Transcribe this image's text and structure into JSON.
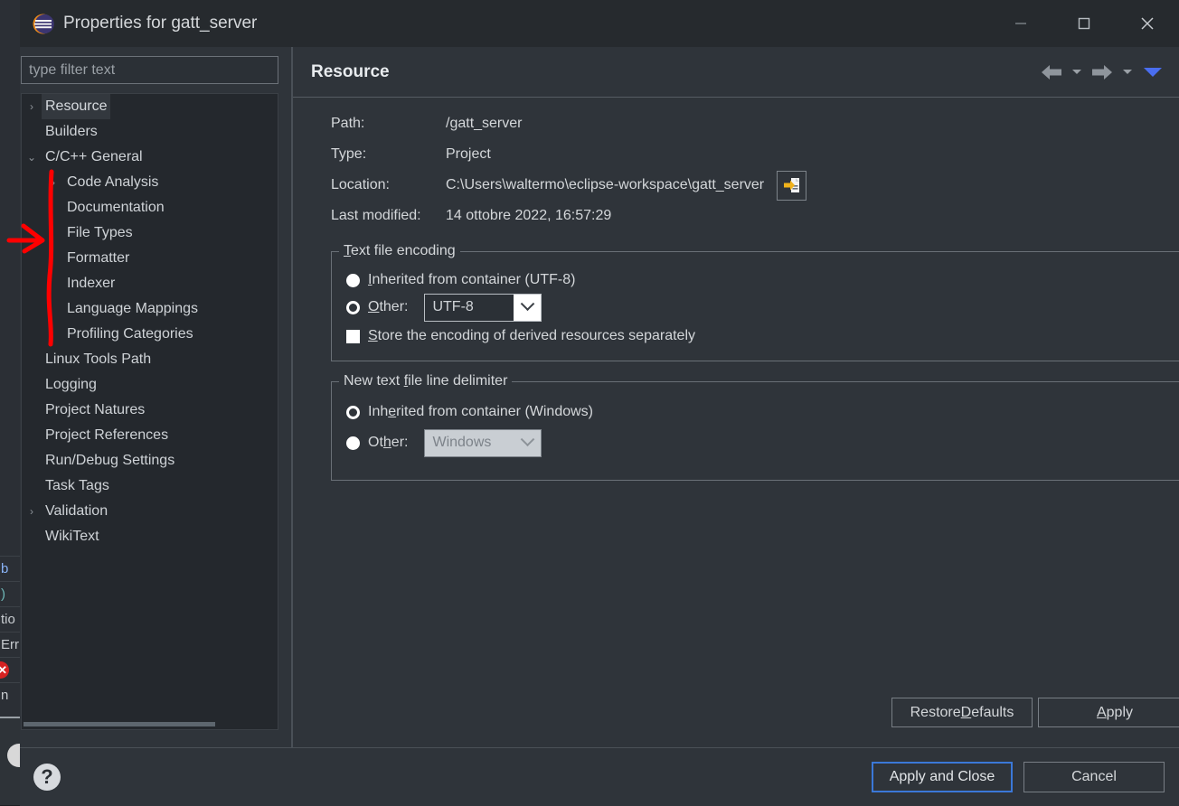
{
  "window": {
    "title": "Properties for gatt_server",
    "logo_icon": "eclipse-logo-icon",
    "minimize_icon": "minimize-icon",
    "maximize_icon": "maximize-icon",
    "close_icon": "close-icon"
  },
  "sidebar": {
    "filter_placeholder": "type filter text",
    "items": [
      {
        "label": "Resource",
        "depth": 0,
        "twisty": "collapsed",
        "selected": true
      },
      {
        "label": "Builders",
        "depth": 0,
        "twisty": "none",
        "selected": false
      },
      {
        "label": "C/C++ General",
        "depth": 0,
        "twisty": "expanded",
        "selected": false
      },
      {
        "label": "Code Analysis",
        "depth": 1,
        "twisty": "collapsed",
        "selected": false
      },
      {
        "label": "Documentation",
        "depth": 1,
        "twisty": "none",
        "selected": false
      },
      {
        "label": "File Types",
        "depth": 1,
        "twisty": "none",
        "selected": false
      },
      {
        "label": "Formatter",
        "depth": 1,
        "twisty": "none",
        "selected": false
      },
      {
        "label": "Indexer",
        "depth": 1,
        "twisty": "none",
        "selected": false
      },
      {
        "label": "Language Mappings",
        "depth": 1,
        "twisty": "none",
        "selected": false
      },
      {
        "label": "Profiling Categories",
        "depth": 1,
        "twisty": "none",
        "selected": false
      },
      {
        "label": "Linux Tools Path",
        "depth": 0,
        "twisty": "none",
        "selected": false
      },
      {
        "label": "Logging",
        "depth": 0,
        "twisty": "none",
        "selected": false
      },
      {
        "label": "Project Natures",
        "depth": 0,
        "twisty": "none",
        "selected": false
      },
      {
        "label": "Project References",
        "depth": 0,
        "twisty": "none",
        "selected": false
      },
      {
        "label": "Run/Debug Settings",
        "depth": 0,
        "twisty": "none",
        "selected": false
      },
      {
        "label": "Task Tags",
        "depth": 0,
        "twisty": "none",
        "selected": false
      },
      {
        "label": "Validation",
        "depth": 0,
        "twisty": "collapsed",
        "selected": false
      },
      {
        "label": "WikiText",
        "depth": 0,
        "twisty": "none",
        "selected": false
      }
    ]
  },
  "content": {
    "page_title": "Resource",
    "nav": {
      "back_icon": "arrow-left-icon",
      "back_menu_icon": "chevron-down-icon",
      "forward_icon": "arrow-right-icon",
      "forward_menu_icon": "chevron-down-icon",
      "view_menu_icon": "triangle-down-icon",
      "view_menu_color": "#4a6ef0"
    },
    "info": [
      {
        "label": "Path:",
        "value": "/gatt_server"
      },
      {
        "label": "Type:",
        "value": "Project"
      },
      {
        "label": "Location:",
        "value": "C:\\Users\\waltermo\\eclipse-workspace\\gatt_server"
      },
      {
        "label": "Last modified:",
        "value": "14 ottobre 2022, 16:57:29"
      }
    ],
    "location_button_icon": "open-file-location-icon",
    "encoding_group": {
      "legend": "Text file encoding",
      "legend_mnemonic": "T",
      "inherited_label": "Inherited from container (UTF-8)",
      "inherited_mnemonic": "I",
      "inherited_selected": false,
      "other_label": "Other:",
      "other_mnemonic": "O",
      "other_selected": true,
      "other_value": "UTF-8",
      "other_enabled": true,
      "store_label": "Store the encoding of derived resources separately",
      "store_mnemonic": "S",
      "store_checked": false
    },
    "delimiter_group": {
      "legend": "New text file line delimiter",
      "legend_mnemonic": "f",
      "inherited_label": "Inherited from container (Windows)",
      "inherited_mnemonic": "e",
      "inherited_selected": true,
      "other_label": "Other:",
      "other_mnemonic": "h",
      "other_selected": false,
      "other_value": "Windows",
      "other_enabled": false
    },
    "restore_defaults_label": "Restore Defaults",
    "restore_defaults_mnemonic": "D",
    "apply_label": "Apply",
    "apply_mnemonic": "A"
  },
  "footer": {
    "help_icon": "help-question-icon",
    "apply_and_close_label": "Apply and Close",
    "cancel_label": "Cancel",
    "focus_color": "#3b78d8"
  },
  "background_ide": {
    "fragments": [
      {
        "text": "b",
        "color": "blue"
      },
      {
        "text": ")",
        "color": "teal"
      },
      {
        "text": "tio",
        "color": "normal"
      },
      {
        "text": "Err",
        "color": "normal"
      },
      {
        "text": "",
        "color": "error"
      },
      {
        "text": "n",
        "color": "normal"
      }
    ]
  },
  "annotations": {
    "color": "#ff0000",
    "arrow_target": "File Types",
    "bracket_covers": [
      "Code Analysis",
      "Documentation",
      "File Types",
      "Formatter",
      "Indexer",
      "Language Mappings",
      "Profiling Categories"
    ]
  }
}
